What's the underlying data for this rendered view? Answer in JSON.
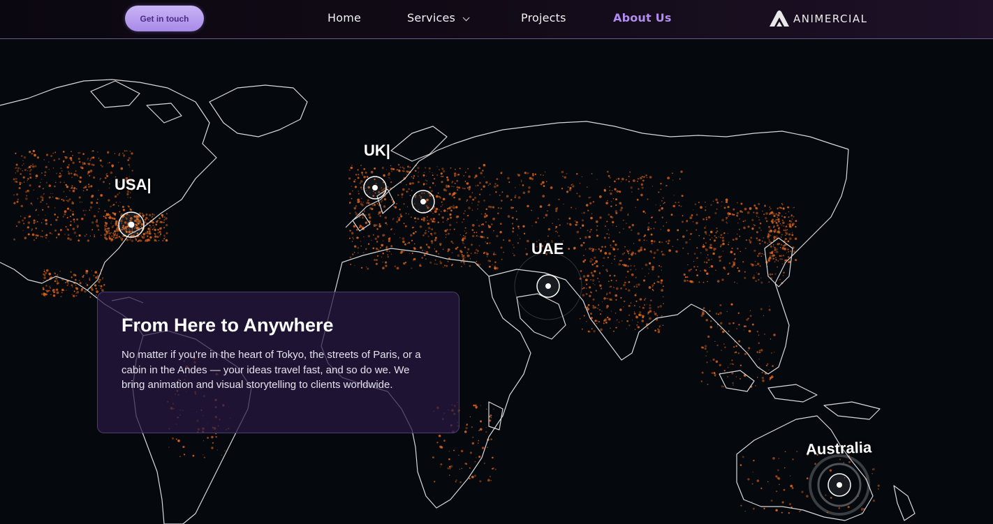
{
  "nav": {
    "cta_label": "Get in touch",
    "links": [
      {
        "label": "Home"
      },
      {
        "label": "Services"
      },
      {
        "label": "Projects"
      },
      {
        "label": "About Us"
      }
    ],
    "active": "About Us",
    "brand": "ANIMERCIAL"
  },
  "map": {
    "locations": [
      {
        "label": "USA"
      },
      {
        "label": "UK"
      },
      {
        "label": "UAE"
      },
      {
        "label": "Australia"
      }
    ]
  },
  "card": {
    "title": "From Here to Anywhere",
    "body": "No matter if you're in the heart of Tokyo, the streets of Paris, or a cabin in the Andes — your ideas travel fast, and so do we. We bring animation and visual storytelling to clients worldwide."
  },
  "colors": {
    "background": "#05080c",
    "accent": "#b38cf2",
    "city_lights": "#e0661c",
    "card": "#281842"
  }
}
